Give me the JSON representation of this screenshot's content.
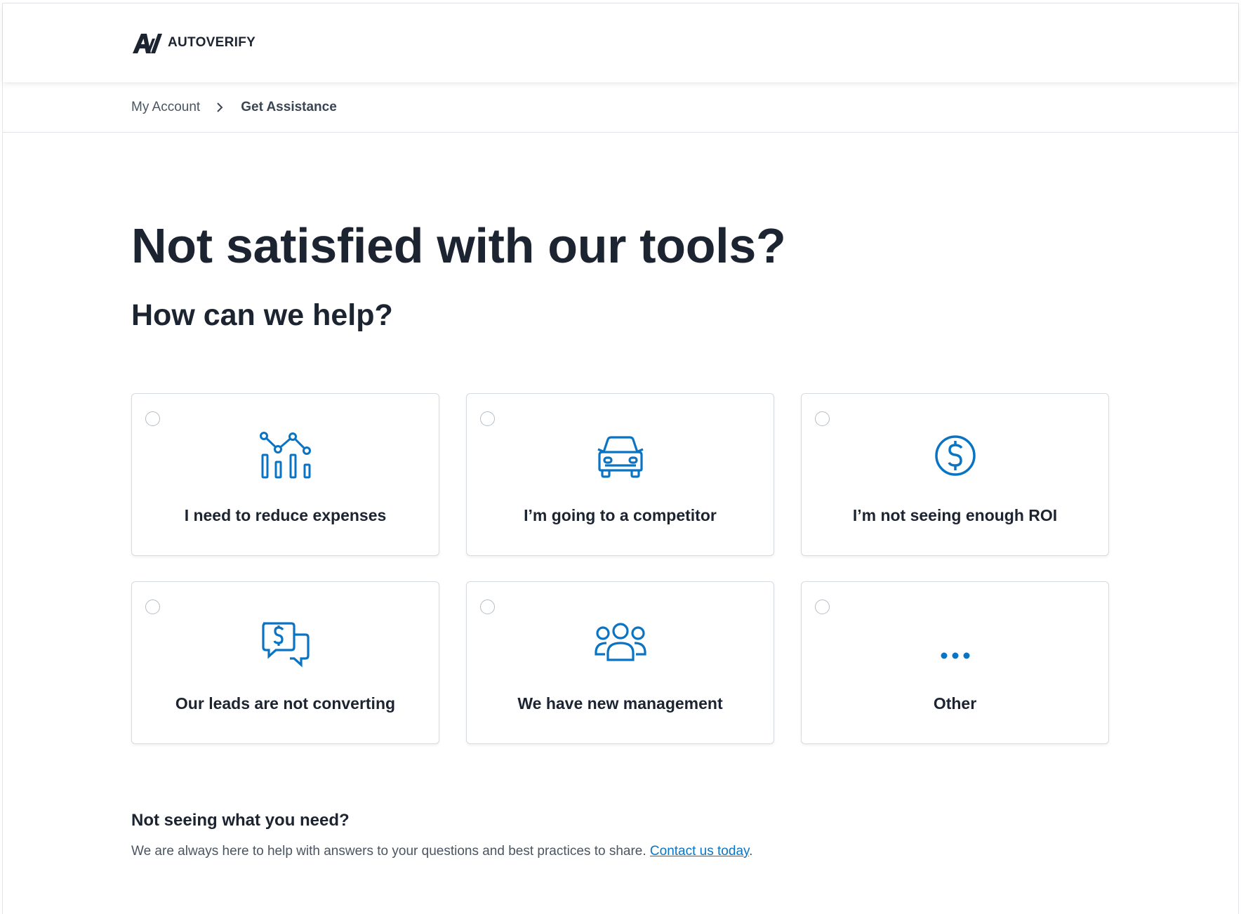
{
  "brand": {
    "name": "AUTOVERIFY",
    "logo_mark": "AV",
    "accent_color": "#0a74c4",
    "text_color": "#1b2430"
  },
  "breadcrumb": {
    "items": [
      {
        "label": "My Account"
      },
      {
        "label": "Get Assistance"
      }
    ],
    "separator_icon": "chevron-right-icon"
  },
  "main": {
    "title": "Not satisfied with our tools?",
    "subtitle": "How can we help?"
  },
  "options": [
    {
      "label": "I need to reduce expenses",
      "icon": "bar-chart-trend-icon",
      "selected": false
    },
    {
      "label": "I’m going to a competitor",
      "icon": "car-icon",
      "selected": false
    },
    {
      "label": "I’m not seeing enough ROI",
      "icon": "dollar-circle-icon",
      "selected": false
    },
    {
      "label": "Our leads are not converting",
      "icon": "chat-dollar-icon",
      "selected": false
    },
    {
      "label": "We have new management",
      "icon": "people-group-icon",
      "selected": false
    },
    {
      "label": "Other",
      "icon": "ellipsis-icon",
      "selected": false
    }
  ],
  "help": {
    "title": "Not seeing what you need?",
    "text": "We are always here to help with answers to your questions and best practices to share. ",
    "link_label": "Contact us today",
    "suffix": "."
  }
}
